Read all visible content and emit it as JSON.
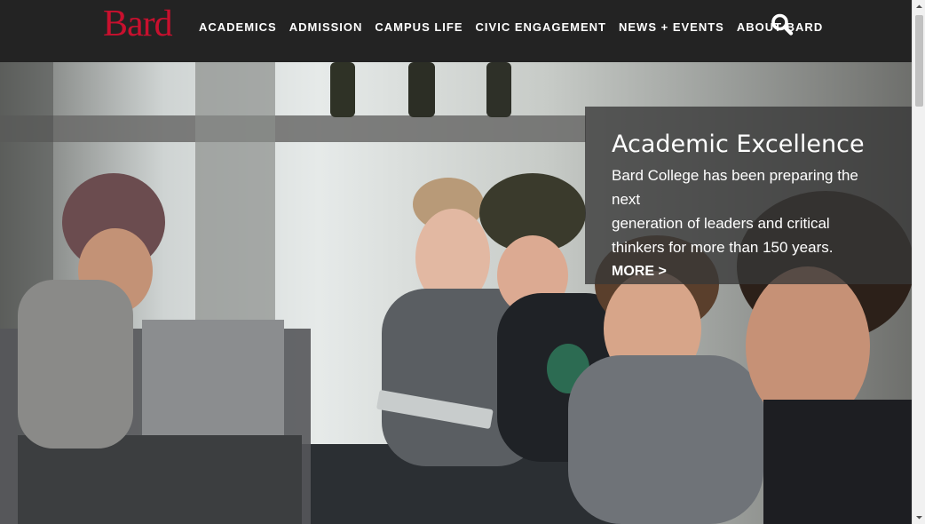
{
  "header": {
    "logo": "Bard",
    "nav": [
      "ACADEMICS",
      "ADMISSION",
      "CAMPUS LIFE",
      "CIVIC ENGAGEMENT",
      "NEWS + EVENTS",
      "ABOUT BARD"
    ],
    "search_icon": "search-icon"
  },
  "hero": {
    "title": "Academic Excellence",
    "line1": "Bard College has been preparing the next",
    "line2": "generation of leaders and critical",
    "line3": "thinkers for more than 150 years.",
    "cta": "MORE >"
  },
  "colors": {
    "header_bg": "#232323",
    "logo_red": "#c8102e"
  }
}
